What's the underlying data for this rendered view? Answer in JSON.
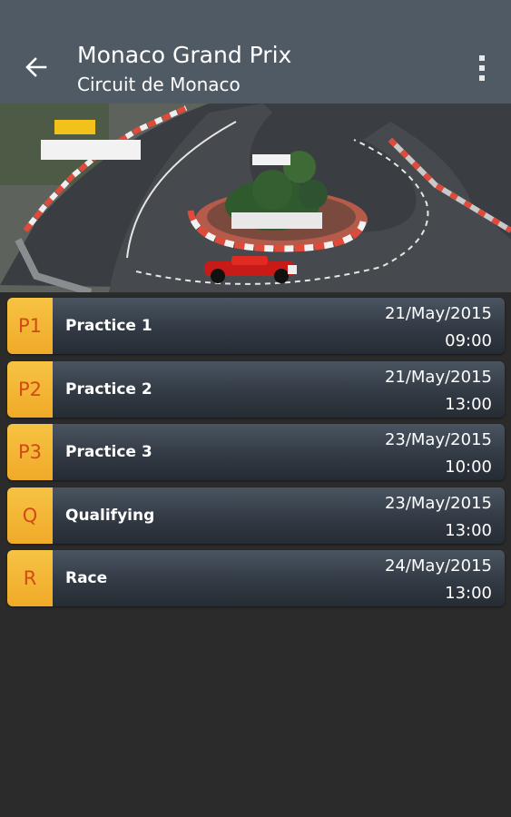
{
  "header": {
    "title": "Monaco Grand Prix",
    "subtitle": "Circuit de Monaco",
    "back_icon": "arrow-left-icon",
    "menu_icon": "overflow-menu-icon"
  },
  "hero": {
    "description_icon": "circuit-photo"
  },
  "colors": {
    "appbar": "#505a64",
    "background": "#2b2b2b",
    "badge": "#f0aa28",
    "badge_text": "#d24a18"
  },
  "sessions": [
    {
      "code": "P1",
      "name": "Practice 1",
      "date": "21/May/2015",
      "time": "09:00"
    },
    {
      "code": "P2",
      "name": "Practice 2",
      "date": "21/May/2015",
      "time": "13:00"
    },
    {
      "code": "P3",
      "name": "Practice 3",
      "date": "23/May/2015",
      "time": "10:00"
    },
    {
      "code": "Q",
      "name": "Qualifying",
      "date": "23/May/2015",
      "time": "13:00"
    },
    {
      "code": "R",
      "name": "Race",
      "date": "24/May/2015",
      "time": "13:00"
    }
  ]
}
